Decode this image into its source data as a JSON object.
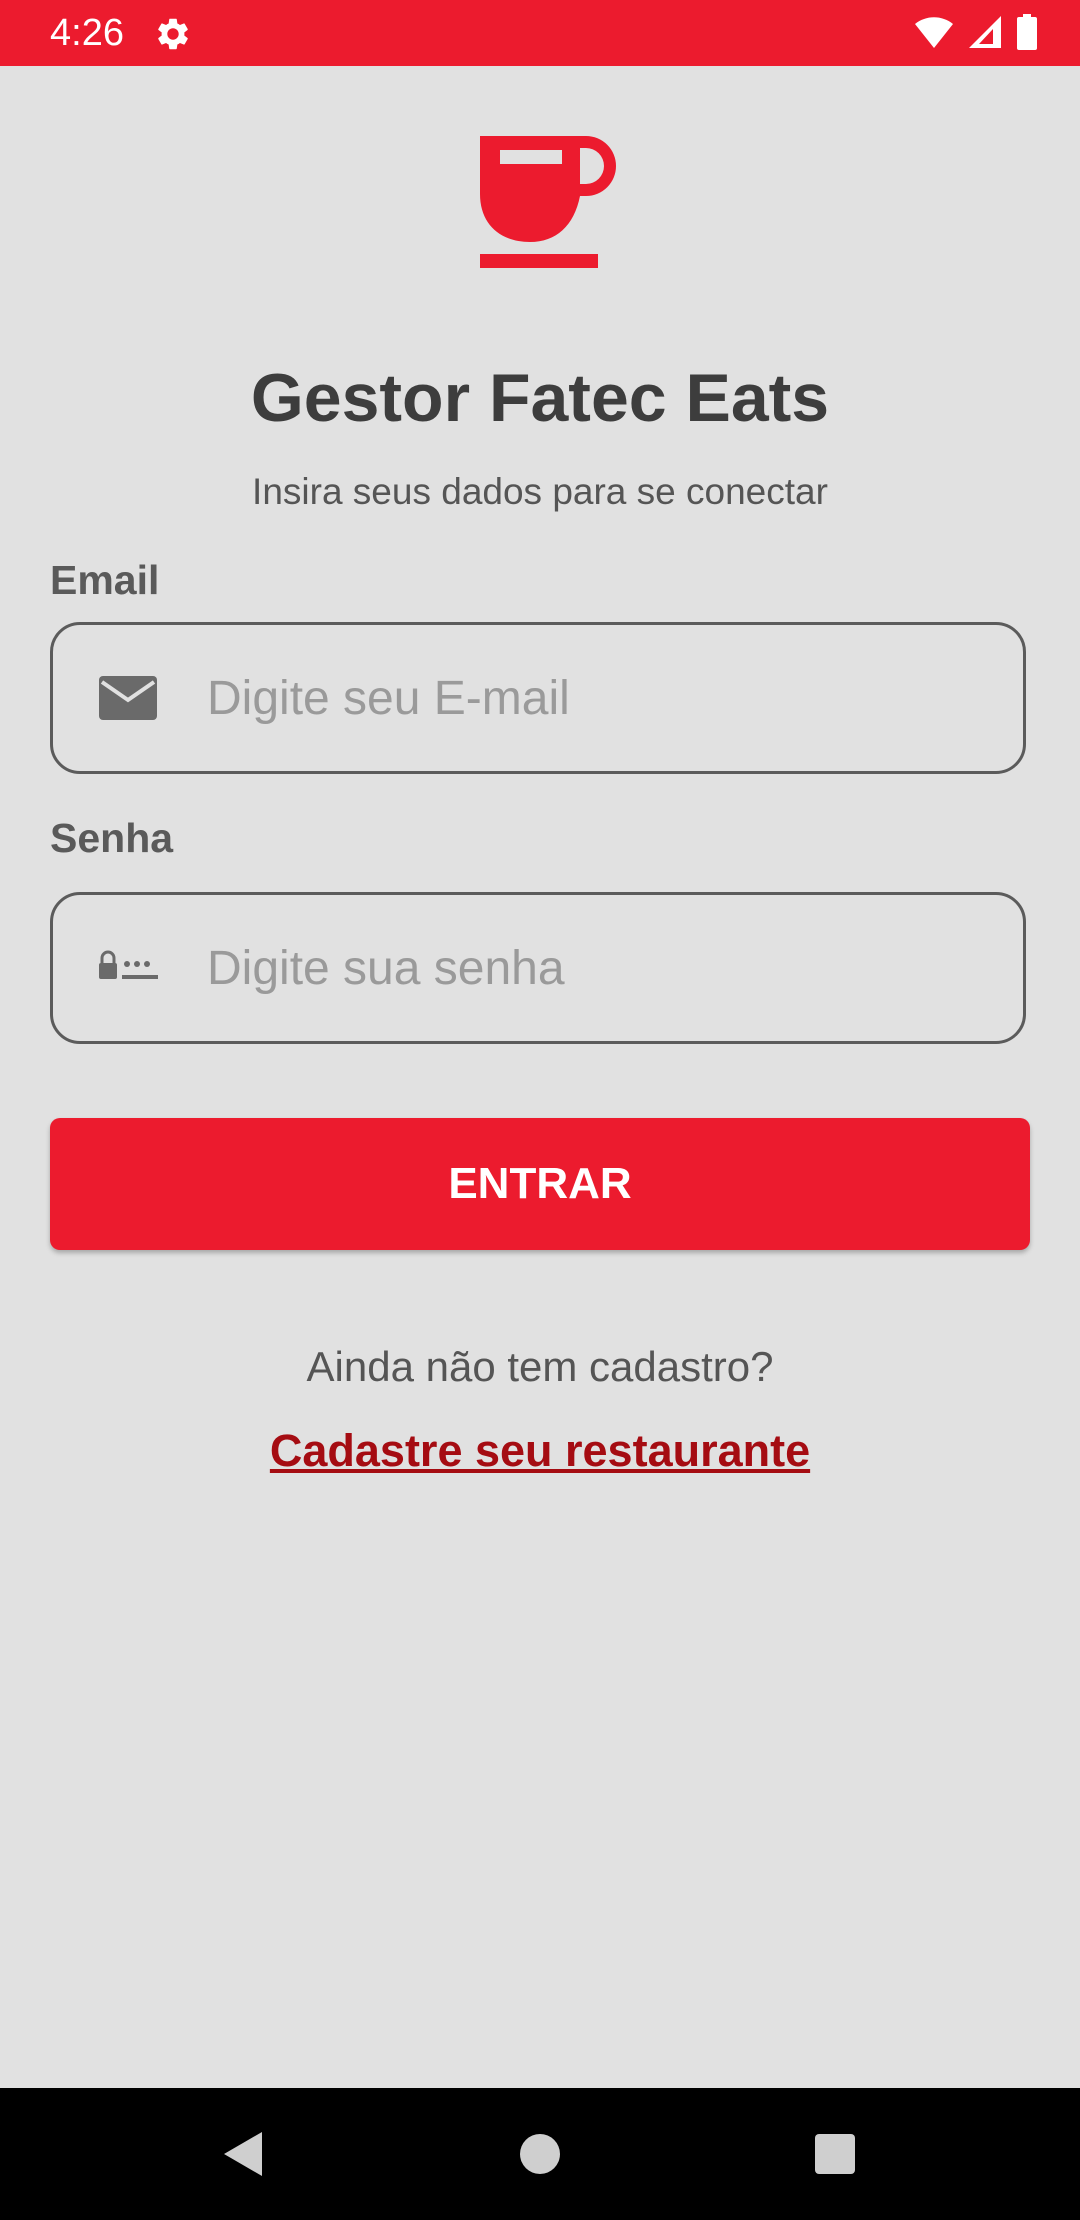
{
  "status_bar": {
    "time": "4:26",
    "background_color": "#ec1b2e",
    "icons": [
      "settings-gear-icon",
      "wifi-icon",
      "cellular-signal-icon",
      "battery-icon"
    ]
  },
  "app": {
    "logo_icon": "coffee-cup-icon",
    "brand_color": "#ec1b2e",
    "title": "Gestor Fatec Eats",
    "subtitle": "Insira seus dados para se conectar"
  },
  "form": {
    "email": {
      "label": "Email",
      "placeholder": "Digite seu E-mail",
      "value": "",
      "icon": "email-envelope-icon"
    },
    "password": {
      "label": "Senha",
      "placeholder": "Digite sua senha",
      "value": "",
      "icon": "password-lock-icon"
    },
    "submit_label": "ENTRAR"
  },
  "register": {
    "prompt": "Ainda não tem cadastro?",
    "link_text": "Cadastre seu restaurante",
    "link_color": "#a50c12"
  },
  "nav_bar": {
    "buttons": [
      "back-icon",
      "home-icon",
      "recents-icon"
    ]
  }
}
